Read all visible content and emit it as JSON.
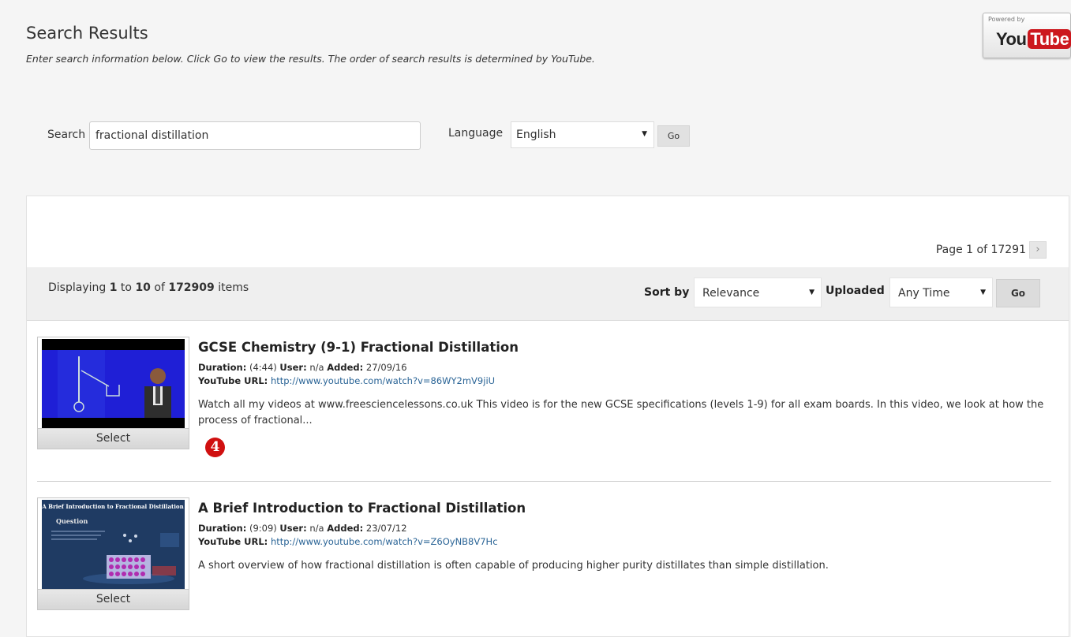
{
  "header": {
    "title": "Search Results",
    "instructions": "Enter search information below. Click Go to view the results. The order of search results is determined by YouTube."
  },
  "youtube_badge": {
    "powered_by": "Powered by",
    "logo_you": "You",
    "logo_tube": "Tube",
    "brand_color": "#cc181e"
  },
  "search": {
    "label": "Search",
    "value": "fractional distillation",
    "language_label": "Language",
    "language_value": "English",
    "go_label": "Go"
  },
  "results": {
    "pager": {
      "text": "Page 1 of 17291",
      "next_icon": "›"
    },
    "display": {
      "prefix": "Displaying ",
      "from": "1",
      "to_word": " to ",
      "to": "10",
      "of_word": " of ",
      "total": "172909",
      "suffix": " items"
    },
    "sort_label": "Sort by",
    "sort_value": "Relevance",
    "uploaded_label": "Uploaded",
    "uploaded_value": "Any Time",
    "go_label": "Go",
    "items": [
      {
        "title": "GCSE Chemistry (9-1) Fractional Distillation",
        "duration_label": "Duration:",
        "duration": "(4:44)",
        "user_label": "User:",
        "user": "n/a",
        "added_label": "Added:",
        "added": "27/09/16",
        "url_label": "YouTube URL:",
        "url": "http://www.youtube.com/watch?v=86WY2mV9jiU",
        "description": "Watch all my videos at www.freesciencelessons.co.uk This video is for the new GCSE specifications (levels 1-9) for all exam boards. In this video, we look at how the process of fractional...",
        "select_label": "Select"
      },
      {
        "title": "A Brief Introduction to Fractional Distillation",
        "duration_label": "Duration:",
        "duration": "(9:09)",
        "user_label": "User:",
        "user": "n/a",
        "added_label": "Added:",
        "added": "23/07/12",
        "url_label": "YouTube URL:",
        "url": "http://www.youtube.com/watch?v=Z6OyNB8V7Hc",
        "description": "A short overview of how fractional distillation is often capable of producing higher purity distillates than simple distillation.",
        "select_label": "Select",
        "thumb_title": "A Brief Introduction to Fractional Distillation",
        "thumb_subtitle": "Question"
      }
    ]
  },
  "step_marker": "4"
}
